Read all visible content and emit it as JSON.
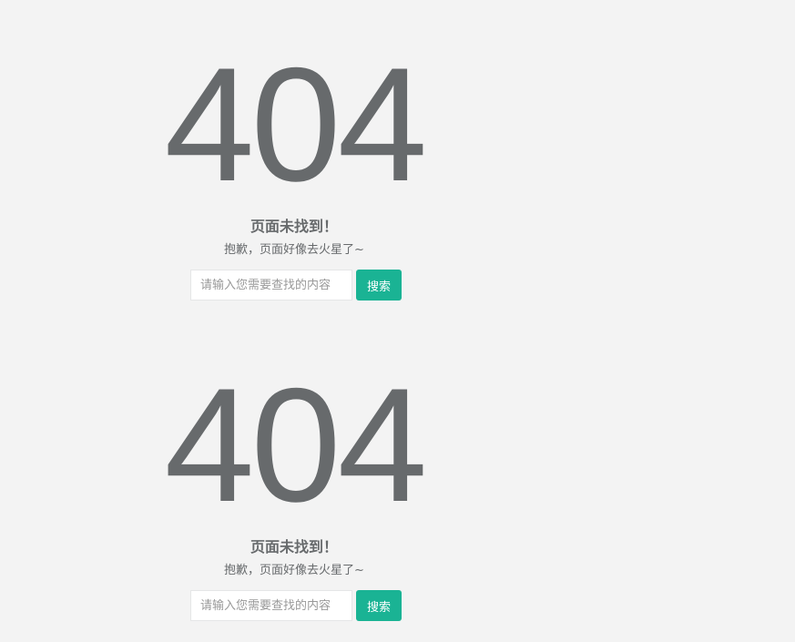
{
  "error_blocks": [
    {
      "code": "404",
      "title": "页面未找到！",
      "subtitle": "抱歉，页面好像去火星了~",
      "search": {
        "placeholder": "请输入您需要查找的内容",
        "value": "",
        "button_label": "搜索"
      }
    },
    {
      "code": "404",
      "title": "页面未找到！",
      "subtitle": "抱歉，页面好像去火星了~",
      "search": {
        "placeholder": "请输入您需要查找的内容",
        "value": "",
        "button_label": "搜索"
      }
    }
  ],
  "colors": {
    "background": "#f3f3f3",
    "text": "#676a6c",
    "button": "#1ab394",
    "button_text": "#ffffff",
    "input_border": "#e5e6e7"
  }
}
